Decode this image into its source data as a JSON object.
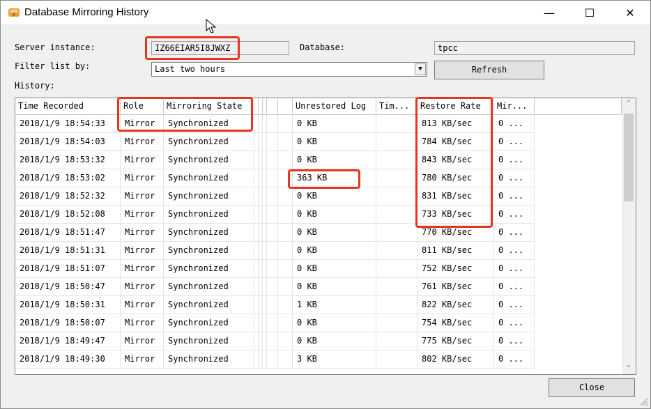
{
  "window": {
    "title": "Database Mirroring History",
    "controls": {
      "minimize": "—",
      "maximize": "☐",
      "close": "✕"
    }
  },
  "form": {
    "server_instance_label": "Server instance:",
    "server_instance_value": "IZ66EIAR5I8JWXZ",
    "database_label": "Database:",
    "database_value": "tpcc",
    "filter_label": "Filter list by:",
    "filter_value": "Last two hours",
    "refresh_label": "Refresh",
    "history_label": "History:"
  },
  "table": {
    "headers": [
      "Time Recorded",
      "Role",
      "Mirroring State",
      "",
      "",
      "",
      "",
      "",
      "Unrestored Log",
      "Tim...",
      "Restore Rate",
      "Mir..."
    ],
    "rows": [
      [
        "2018/1/9 18:54:33",
        "Mirror",
        "Synchronized",
        "0 KB",
        "813 KB/sec",
        "0 ..."
      ],
      [
        "2018/1/9 18:54:03",
        "Mirror",
        "Synchronized",
        "0 KB",
        "784 KB/sec",
        "0 ..."
      ],
      [
        "2018/1/9 18:53:32",
        "Mirror",
        "Synchronized",
        "0 KB",
        "843 KB/sec",
        "0 ..."
      ],
      [
        "2018/1/9 18:53:02",
        "Mirror",
        "Synchronized",
        "363 KB",
        "780 KB/sec",
        "0 ..."
      ],
      [
        "2018/1/9 18:52:32",
        "Mirror",
        "Synchronized",
        "0 KB",
        "831 KB/sec",
        "0 ..."
      ],
      [
        "2018/1/9 18:52:08",
        "Mirror",
        "Synchronized",
        "0 KB",
        "733 KB/sec",
        "0 ..."
      ],
      [
        "2018/1/9 18:51:47",
        "Mirror",
        "Synchronized",
        "0 KB",
        "770 KB/sec",
        "0 ..."
      ],
      [
        "2018/1/9 18:51:31",
        "Mirror",
        "Synchronized",
        "0 KB",
        "811 KB/sec",
        "0 ..."
      ],
      [
        "2018/1/9 18:51:07",
        "Mirror",
        "Synchronized",
        "0 KB",
        "752 KB/sec",
        "0 ..."
      ],
      [
        "2018/1/9 18:50:47",
        "Mirror",
        "Synchronized",
        "0 KB",
        "761 KB/sec",
        "0 ..."
      ],
      [
        "2018/1/9 18:50:31",
        "Mirror",
        "Synchronized",
        "1 KB",
        "822 KB/sec",
        "0 ..."
      ],
      [
        "2018/1/9 18:50:07",
        "Mirror",
        "Synchronized",
        "0 KB",
        "754 KB/sec",
        "0 ..."
      ],
      [
        "2018/1/9 18:49:47",
        "Mirror",
        "Synchronized",
        "0 KB",
        "775 KB/sec",
        "0 ..."
      ],
      [
        "2018/1/9 18:49:30",
        "Mirror",
        "Synchronized",
        "3 KB",
        "802 KB/sec",
        "0 ..."
      ]
    ]
  },
  "footer": {
    "close_label": "Close"
  },
  "colors": {
    "highlight": "#e8341c",
    "background": "#f0f0f0"
  }
}
